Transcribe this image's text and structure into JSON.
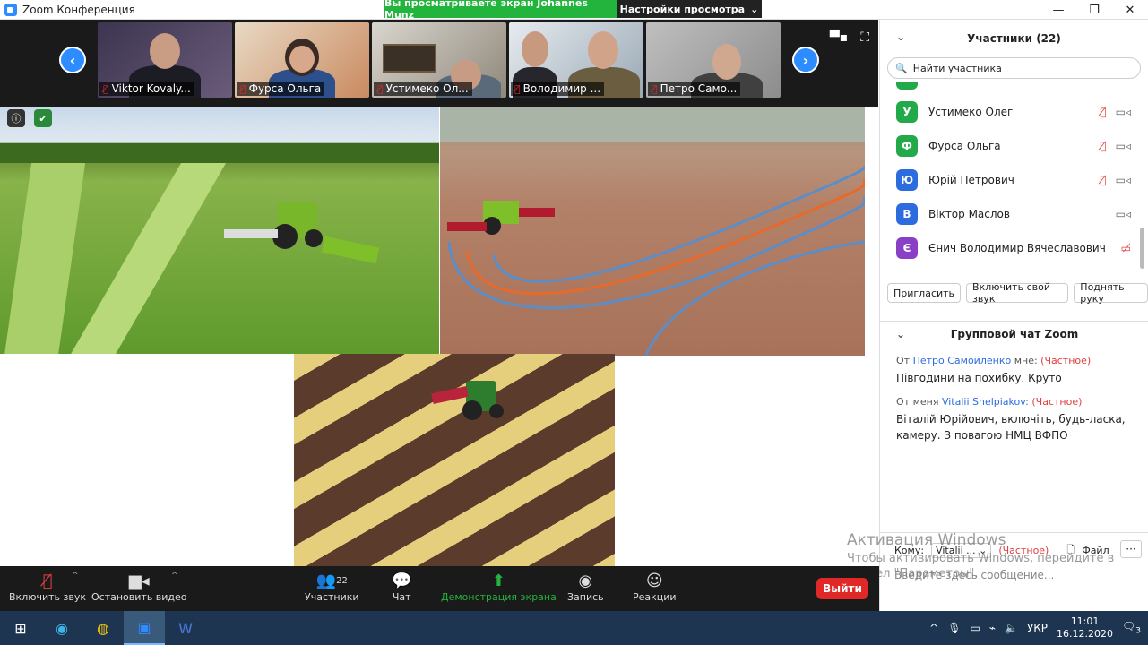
{
  "window": {
    "title": "Zoom Конференция",
    "minimize": "—",
    "maximize": "❐",
    "close": "✕"
  },
  "banner": {
    "sharing_text": "Вы просматриваете экран Johannes Munz",
    "view_options": "Настройки просмотра"
  },
  "video_strip": [
    {
      "name": "Viktor Kovaly..."
    },
    {
      "name": "Фурса Ольга"
    },
    {
      "name": "Устимеко Ол..."
    },
    {
      "name": "Володимир ..."
    },
    {
      "name": "Петро Само..."
    }
  ],
  "participants_panel": {
    "title": "Участники (22)",
    "search_placeholder": "Найти участника",
    "participants": [
      {
        "initial": "У",
        "name": "Устимеко Олег",
        "color": "#22a94a",
        "muted": true
      },
      {
        "initial": "Ф",
        "name": "Фурса Ольга",
        "color": "#22a94a",
        "muted": true
      },
      {
        "initial": "Ю",
        "name": "Юрій Петрович",
        "color": "#2d6cdf",
        "muted": true
      },
      {
        "initial": "В",
        "name": "Віктор Маслов",
        "color": "#2d6cdf",
        "muted": false
      },
      {
        "initial": "Є",
        "name": "Єнич Володимир Вячеславович",
        "color": "#8a3fc7",
        "muted": false,
        "video_off": true
      }
    ],
    "buttons": {
      "invite": "Пригласить",
      "unmute_me": "Включить свой звук",
      "raise_hand": "Поднять руку"
    }
  },
  "chat": {
    "title": "Групповой чат Zoom",
    "messages": [
      {
        "prefix": "От",
        "sender": "Петро Самойленко",
        "suffix": "мне:",
        "private": "(Частное)",
        "text": "Півгодини на похибку. Круто"
      },
      {
        "prefix": "От меня",
        "sender": "Vitalii Shelpiakov:",
        "suffix": "",
        "private": "(Частное)",
        "text": "Віталій Юрійович, включіть, будь-ласка, камеру. З повагою НМЦ ВФПО"
      }
    ],
    "to_label": "Кому:",
    "to_value": "Vitalii ...",
    "to_private": "(Частное)",
    "file_label": "Файл",
    "more": "···",
    "input_placeholder": "Введите здесь сообщение..."
  },
  "windows_activation": {
    "line1": "Активация Windows",
    "line2": "Чтобы активировать Windows, перейдите в раздел \"Параметры\"."
  },
  "toolbar": {
    "mute": "Включить звук",
    "video": "Остановить видео",
    "participants": "Участники",
    "participants_count": "22",
    "chat": "Чат",
    "share": "Демонстрация экрана",
    "record": "Запись",
    "reactions": "Реакции",
    "end": "Выйти"
  },
  "taskbar": {
    "language": "УКР",
    "time": "11:01",
    "date": "16.12.2020",
    "notifications": "3"
  }
}
